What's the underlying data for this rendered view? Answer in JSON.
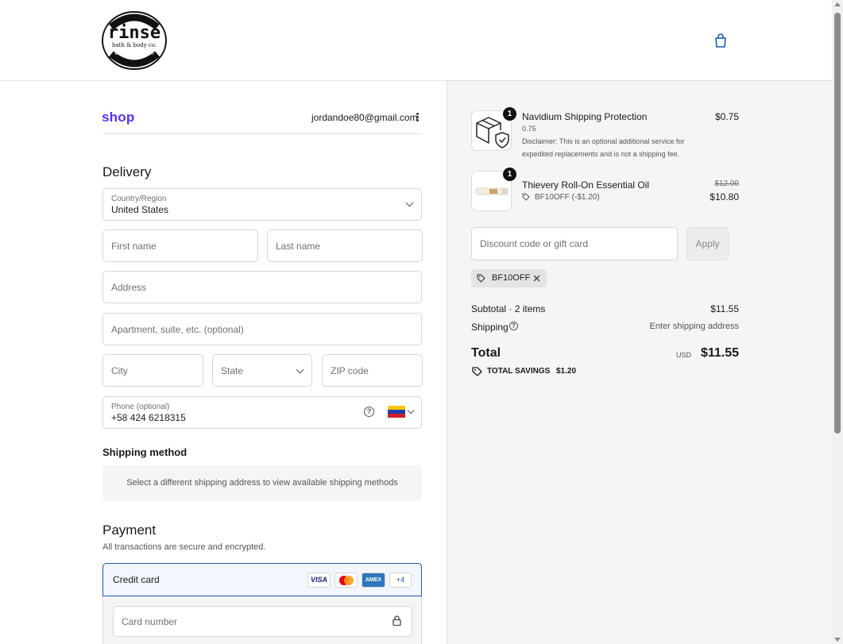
{
  "header": {
    "logo": {
      "line1": "rinse",
      "line2": "bath & body co.",
      "arc_top": "fresh • natural",
      "arc_bottom": "www.rinsebody.com",
      "bottom": "monroe, georgia"
    },
    "cart_icon": "shopping-bag-icon"
  },
  "account": {
    "shop_label": "shop",
    "email": "jordandoe80@gmail.com"
  },
  "delivery": {
    "title": "Delivery",
    "country": {
      "label": "Country/Region",
      "value": "United States"
    },
    "first_name": {
      "placeholder": "First name"
    },
    "last_name": {
      "placeholder": "Last name"
    },
    "address": {
      "placeholder": "Address"
    },
    "apartment": {
      "placeholder": "Apartment, suite, etc. (optional)"
    },
    "city": {
      "placeholder": "City"
    },
    "state": {
      "placeholder": "State"
    },
    "zip": {
      "placeholder": "ZIP code"
    },
    "phone": {
      "label": "Phone (optional)",
      "value": "+58 424 6218315",
      "help": "?"
    }
  },
  "shipping_method": {
    "title": "Shipping method",
    "message": "Select a different shipping address to view available shipping methods"
  },
  "payment": {
    "title": "Payment",
    "subtitle": "All transactions are secure and encrypted.",
    "method_label": "Credit card",
    "cards": [
      "VISA",
      "AMEX",
      "+4"
    ],
    "card_number": {
      "placeholder": "Card number"
    }
  },
  "order": {
    "items": [
      {
        "name": "Navidium Shipping Protection",
        "qty": "1",
        "variant": "0.75",
        "note_line1": "Disclaimer: This is an optional additional service for",
        "note_line2": "expedited replacements and is not a shipping fee.",
        "price": "$0.75"
      },
      {
        "name": "Thievery Roll-On Essential Oil",
        "qty": "1",
        "discount": "BF10OFF (-$1.20)",
        "original_price": "$12.00",
        "price": "$10.80"
      }
    ],
    "discount_input": {
      "placeholder": "Discount code or gift card"
    },
    "apply_label": "Apply",
    "applied_code": "BF10OFF",
    "subtotal_label": "Subtotal · 2 items",
    "subtotal_value": "$11.55",
    "shipping_label": "Shipping",
    "shipping_value": "Enter shipping address",
    "total_label": "Total",
    "currency": "USD",
    "total_value": "$11.55",
    "savings_label": "TOTAL SAVINGS",
    "savings_value": "$1.20"
  },
  "colors": {
    "accent": "#1c5aa8",
    "shop_purple": "#5a31f4",
    "panel_bg": "#f5f5f5"
  }
}
